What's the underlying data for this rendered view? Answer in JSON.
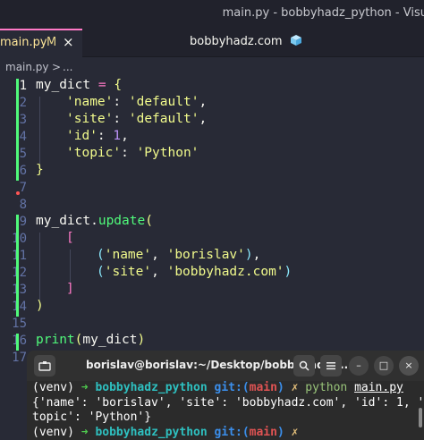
{
  "window": {
    "title": "main.py - bobbyhadz_python - Visu"
  },
  "tabs": [
    {
      "label": "main.py",
      "status": "M"
    }
  ],
  "header_center": {
    "label": "bobbyhadz.com",
    "emoji": "🧊"
  },
  "breadcrumb": {
    "file": "main.py",
    "separator": ">",
    "more": "..."
  },
  "editor": {
    "line_numbers": [
      "1",
      "2",
      "3",
      "4",
      "5",
      "6",
      "7",
      "8",
      "9",
      "10",
      "11",
      "12",
      "13",
      "14",
      "15",
      "16",
      "17"
    ],
    "code": {
      "l1": {
        "var": "my_dict",
        "op": " = ",
        "brace": "{"
      },
      "l2": {
        "key": "'name'",
        "colon": ": ",
        "val": "'default'",
        "comma": ","
      },
      "l3": {
        "key": "'site'",
        "colon": ": ",
        "val": "'default'",
        "comma": ","
      },
      "l4": {
        "key": "'id'",
        "colon": ": ",
        "val": "1",
        "comma": ","
      },
      "l5": {
        "key": "'topic'",
        "colon": ": ",
        "val": "'Python'"
      },
      "l6": {
        "brace": "}"
      },
      "l9": {
        "obj": "my_dict",
        "dot": ".",
        "method": "update",
        "paren": "("
      },
      "l10": {
        "bracket": "["
      },
      "l11": {
        "open": "(",
        "a": "'name'",
        "sep": ", ",
        "b": "'borislav'",
        "close": ")",
        "comma": ","
      },
      "l12": {
        "open": "(",
        "a": "'site'",
        "sep": ", ",
        "b": "'bobbyhadz.com'",
        "close": ")"
      },
      "l13": {
        "bracket": "]"
      },
      "l14": {
        "paren": ")"
      },
      "l16": {
        "fn": "print",
        "open": "(",
        "arg": "my_dict",
        "close": ")"
      }
    }
  },
  "terminal": {
    "title": "borislav@borislav:~/Desktop/bobbyhadz_...",
    "buttons": {
      "new_tab": "new-terminal-icon",
      "search": "search-icon",
      "menu": "menu-icon",
      "minimize": "–",
      "maximize": "□",
      "close": "×"
    },
    "line1": {
      "venv": "(venv) ",
      "arrow": "➜ ",
      "repo": "bobbyhadz_python",
      "git": " git:(",
      "branch": "main",
      "git_close": ")",
      "x": " ✗ ",
      "cmd": "python",
      "file": "main.py"
    },
    "line2": "{'name': 'borislav', 'site': 'bobbyhadz.com', 'id': 1, '",
    "line3": "topic': 'Python'}",
    "line4": {
      "venv": "(venv) ",
      "arrow": "➜ ",
      "repo": "bobbyhadz_python",
      "git": " git:(",
      "branch": "main",
      "git_close": ")",
      "x": " ✗"
    }
  },
  "colors": {
    "editor_bg": "#282a36",
    "accent_pink": "#ff79c6",
    "string_yellow": "#f1fa8c",
    "function_green": "#50fa7b",
    "number_purple": "#bd93f9",
    "terminal_bg": "#2b2b2b"
  }
}
